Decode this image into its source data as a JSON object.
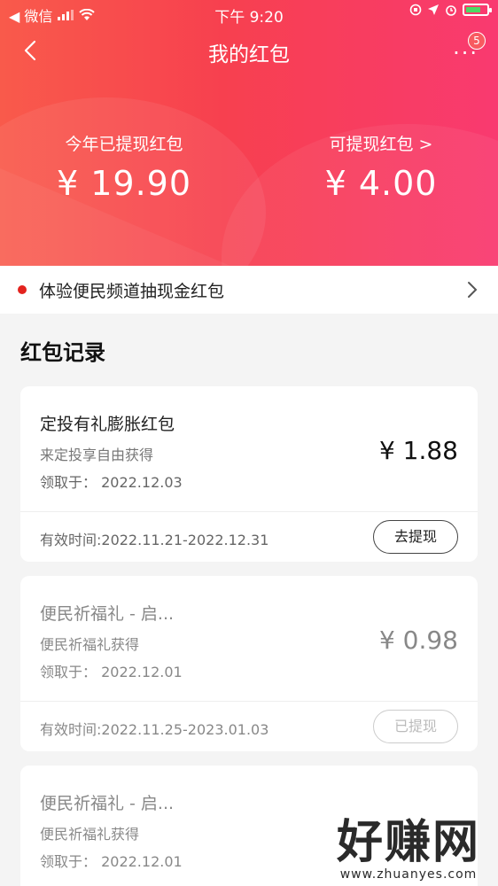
{
  "status_bar": {
    "carrier": "◀ 微信",
    "time": "下午 9:20"
  },
  "nav": {
    "title": "我的红包",
    "more_badge": "5"
  },
  "summary": {
    "withdrawn_label": "今年已提现红包",
    "withdrawn_amount": "¥ 19.90",
    "available_label": "可提现红包 >",
    "available_amount": "¥ 4.00"
  },
  "banner": {
    "text": "体验便民频道抽现金红包"
  },
  "records": {
    "title": "红包记录",
    "items": [
      {
        "name": "定投有礼膨胀红包",
        "source": "来定投享自由获得",
        "date": "领取于： 2022.12.03",
        "amount": "¥ 1.88",
        "valid": "有效时间:2022.11.21-2022.12.31",
        "button": "去提现"
      },
      {
        "name": "便民祈福礼 - 启...",
        "source": "便民祈福礼获得",
        "date": "领取于： 2022.12.01",
        "amount": "¥ 0.98",
        "valid": "有效时间:2022.11.25-2023.01.03",
        "button": "已提现"
      },
      {
        "name": "便民祈福礼 - 启...",
        "source": "便民祈福礼获得",
        "date": "领取于： 2022.12.01"
      }
    ]
  },
  "watermark": {
    "big": "好赚网",
    "small": "www.zhuanyes.com"
  },
  "colors": {
    "hero_start": "#f95a4b",
    "hero_end": "#f93a70",
    "accent_dot": "#e3231e"
  }
}
